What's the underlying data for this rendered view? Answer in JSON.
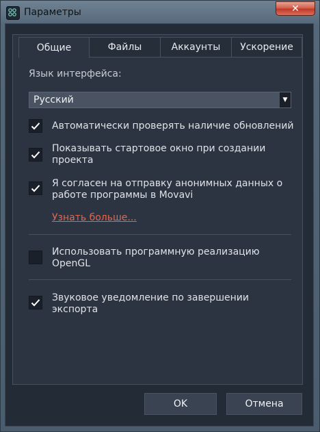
{
  "window": {
    "title": "Параметры",
    "close_label": "✕"
  },
  "tabs": [
    {
      "label": "Общие",
      "active": true
    },
    {
      "label": "Файлы",
      "active": false
    },
    {
      "label": "Аккаунты",
      "active": false
    },
    {
      "label": "Ускорение",
      "active": false
    }
  ],
  "general": {
    "language_label": "Язык интерфейса:",
    "language_value": "Русский",
    "options": [
      {
        "label_line1": "Автоматически проверять наличие обновлений",
        "label_line2": "",
        "checked": true
      },
      {
        "label_line1": "Показывать стартовое окно при создании",
        "label_line2": "проекта",
        "checked": true
      },
      {
        "label_line1": "Я согласен на отправку анонимных данных о",
        "label_line2": "работе программы в Movavi",
        "checked": true
      },
      {
        "label_line1": "Использовать программную реализацию",
        "label_line2": "OpenGL",
        "checked": false
      },
      {
        "label_line1": "Звуковое уведомление по завершении",
        "label_line2": "экспорта",
        "checked": true
      }
    ],
    "learn_more": "Узнать больше..."
  },
  "buttons": {
    "ok": "OK",
    "cancel": "Отмена"
  }
}
